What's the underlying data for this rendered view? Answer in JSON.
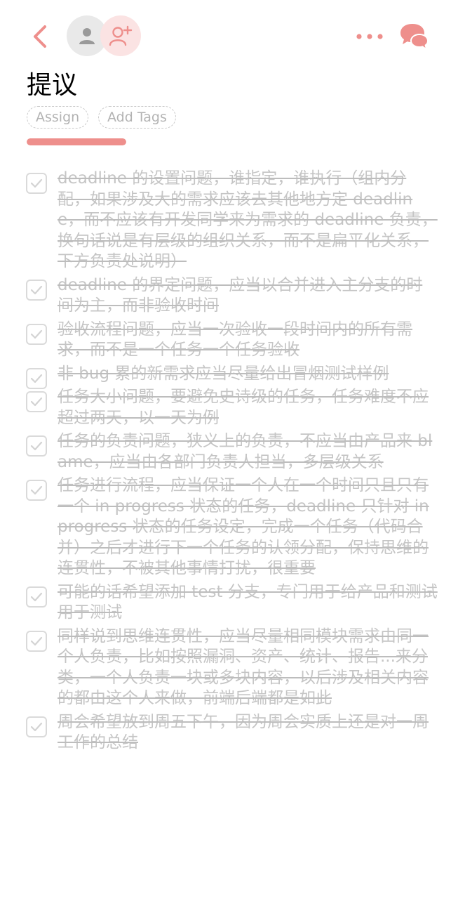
{
  "colors": {
    "accent": "#ee8f8c",
    "accent_light": "#fbe3e3",
    "done_text": "#c5c5c5",
    "checkbox_border": "#dadada"
  },
  "header": {
    "back_icon": "chevron-left-icon",
    "avatar_icon": "user-icon",
    "add_member_icon": "user-plus-icon",
    "more_icon": "more-horizontal-icon",
    "chat_icon": "chat-bubbles-icon"
  },
  "title": "提议",
  "tags": {
    "assign_label": "Assign",
    "add_tags_label": "Add Tags"
  },
  "progress": {
    "fraction": 1.0
  },
  "items": [
    {
      "text": "deadline 的设置问题，谁指定，谁执行（组内分配，如果涉及大的需求应该去其他地方定 deadline，而不应该有开发同学来为需求的 deadline 负责，换句话说是有层级的组织关系，而不是扁平化关系，下方负责处说明）",
      "done": true
    },
    {
      "text": "deadline 的界定问题，应当以合并进入主分支的时间为主，而非验收时间",
      "done": true
    },
    {
      "text": "验收流程问题，应当一次验收一段时间内的所有需求，而不是一个任务一个任务验收",
      "done": true
    },
    {
      "text": "非 bug 累的新需求应当尽量给出冒烟测试样例",
      "done": true
    },
    {
      "text": "任务大小问题，要避免史诗级的任务，任务难度不应超过两天，以一天为例",
      "done": true
    },
    {
      "text": "任务的负责问题，狭义上的负责，不应当由产品来 blame，应当由各部门负责人担当，多层级关系",
      "done": true
    },
    {
      "text": "任务进行流程，应当保证一个人在一个时间只且只有一个 in progress 状态的任务，deadline 只针对 in progress 状态的任务设定，完成一个任务（代码合并）之后才进行下一个任务的认领分配，保持思维的连贯性，不被其他事情打扰，很重要",
      "done": true
    },
    {
      "text": "可能的话希望添加 test 分支，专门用于给产品和测试用于测试",
      "done": true
    },
    {
      "text": "同样说到思维连贯性，应当尽量相同模块需求由同一个人负责，比如按照漏洞、资产、统计、报告...来分类，一个人负责一块或多块内容，以后涉及相关内容的都由这个人来做，前端后端都是如此",
      "done": true
    },
    {
      "text": "周会希望放到周五下午，因为周会实质上还是对一周工作的总结",
      "done": true
    }
  ]
}
